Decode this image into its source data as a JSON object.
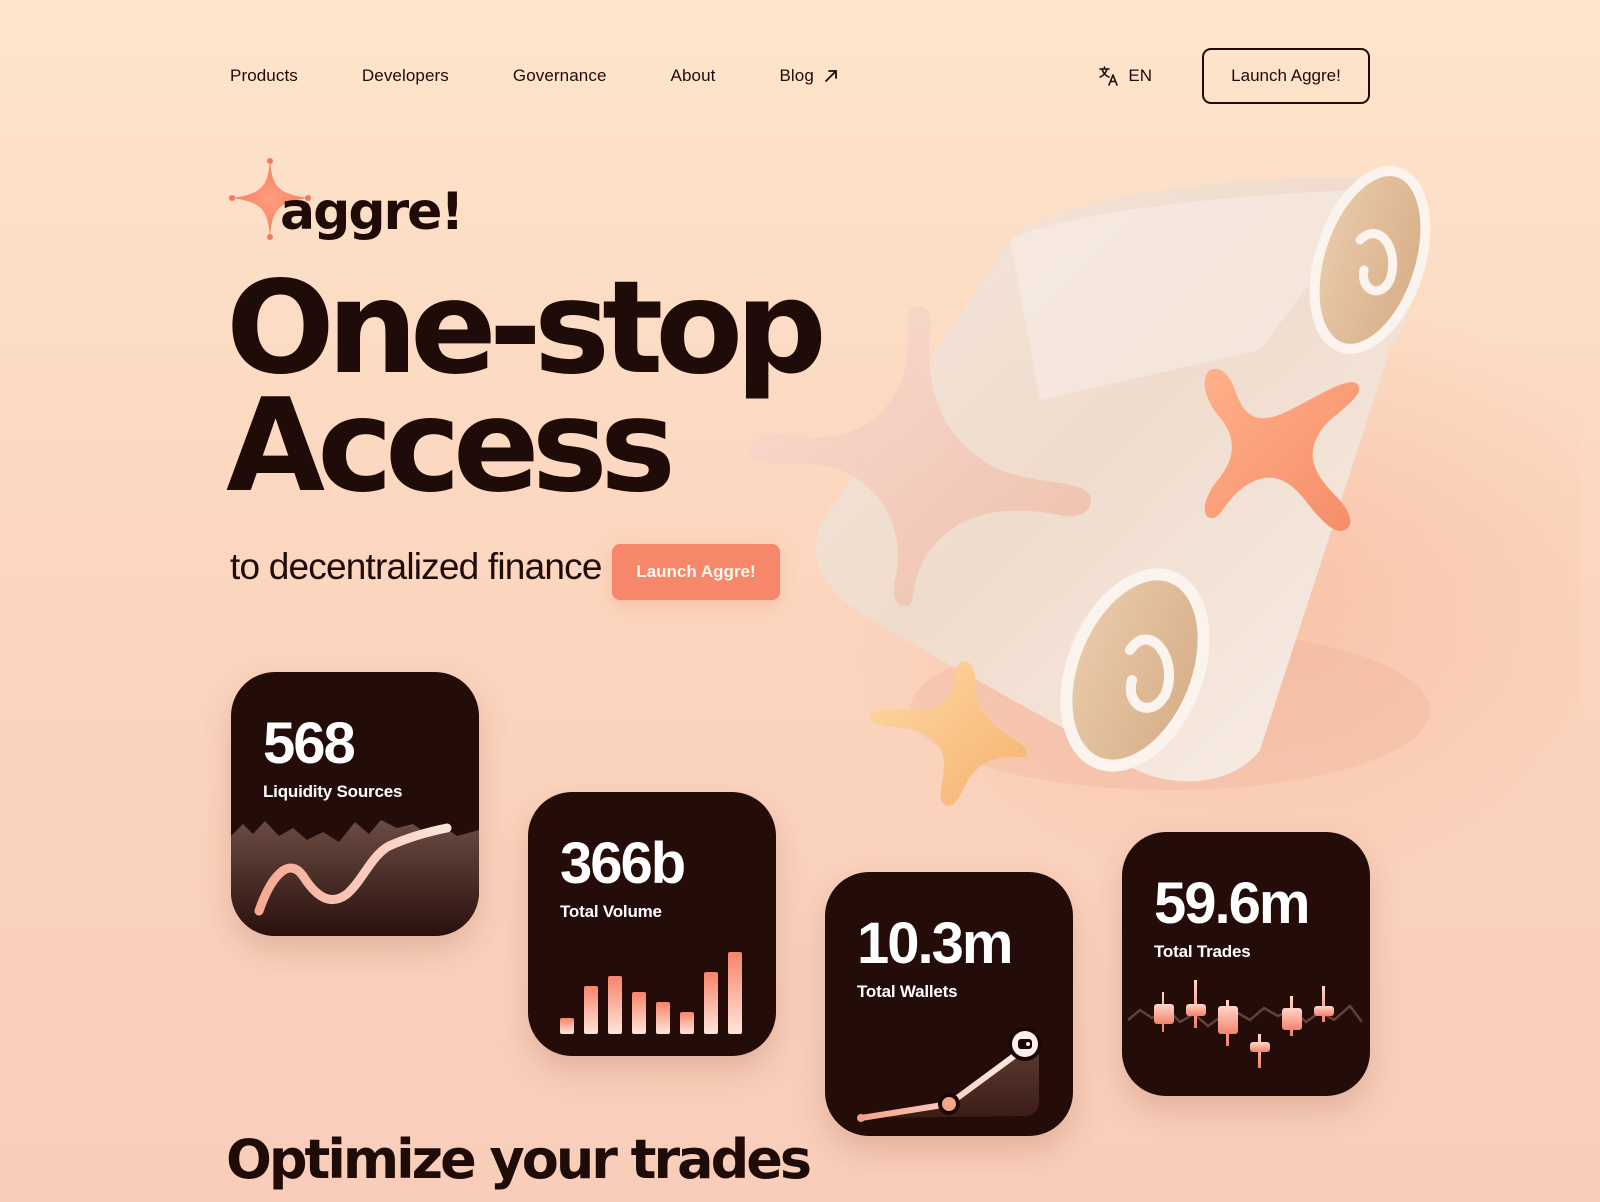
{
  "nav": {
    "items": [
      {
        "label": "Products"
      },
      {
        "label": "Developers"
      },
      {
        "label": "Governance"
      },
      {
        "label": "About"
      },
      {
        "label": "Blog"
      }
    ],
    "language": "EN",
    "launch_label": "Launch Aggre!"
  },
  "logo": {
    "text": "aggre!"
  },
  "hero": {
    "title_line1": "One-stop",
    "title_line2": "Access",
    "subtitle": "to decentralized finance",
    "cta_label": "Launch Aggre!"
  },
  "stats": {
    "liquidity": {
      "value": "568",
      "label": "Liquidity Sources"
    },
    "volume": {
      "value": "366b",
      "label": "Total Volume"
    },
    "wallets": {
      "value": "10.3m",
      "label": "Total Wallets"
    },
    "trades": {
      "value": "59.6m",
      "label": "Total Trades"
    }
  },
  "section": {
    "title": "Optimize your trades"
  },
  "colors": {
    "background": "#fcd6bf",
    "text": "#1f0b08",
    "accent": "#f7876a",
    "card": "#240c09"
  }
}
